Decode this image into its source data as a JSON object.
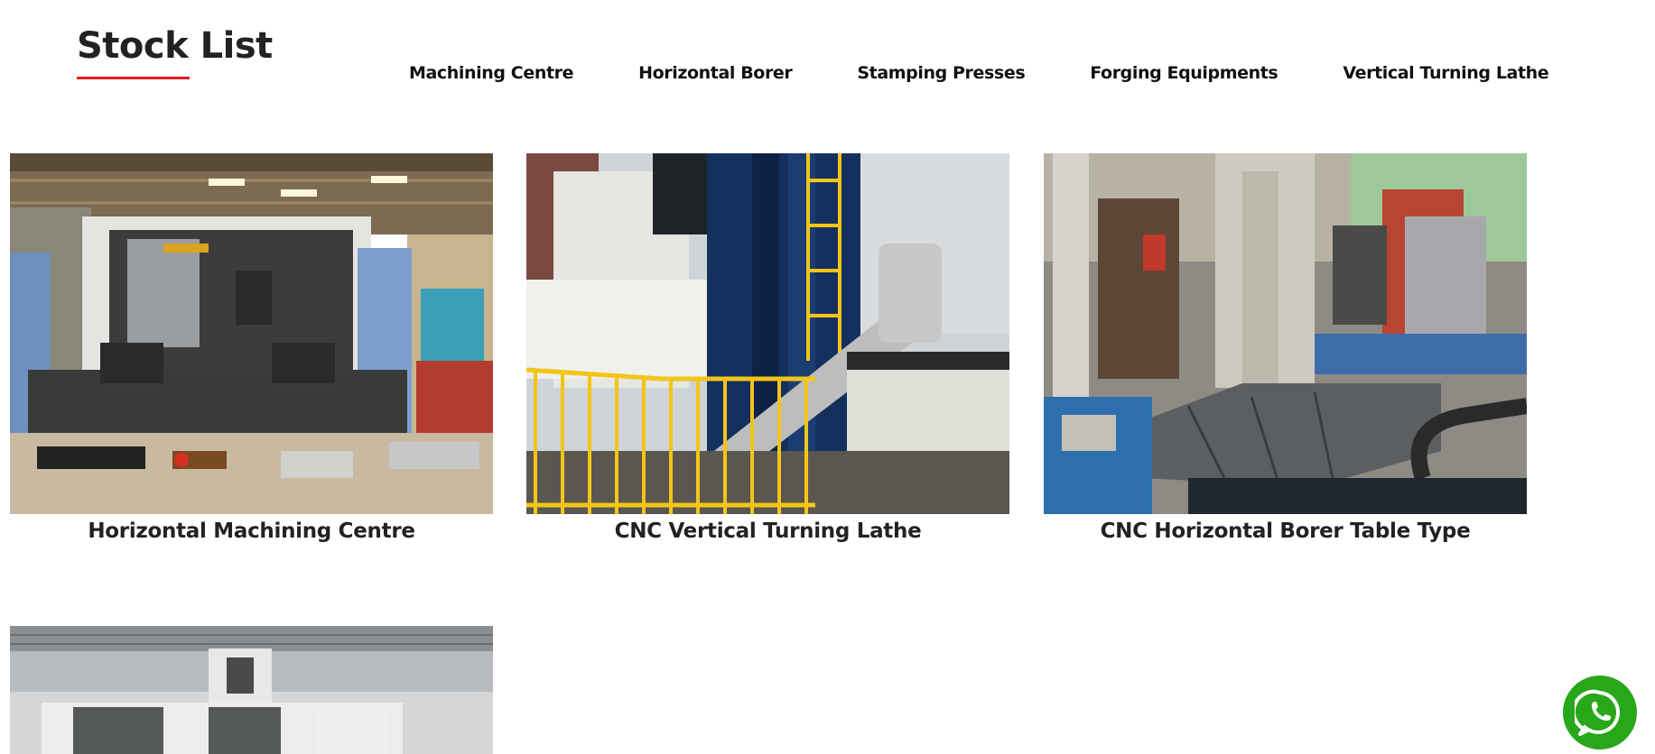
{
  "header": {
    "title": "Stock List",
    "accent_color": "#e02020"
  },
  "tabs": [
    {
      "label": "Machining Centre"
    },
    {
      "label": "Horizontal Borer"
    },
    {
      "label": "Stamping Presses"
    },
    {
      "label": "Forging Equipments"
    },
    {
      "label": "Vertical Turning Lathe"
    }
  ],
  "products": [
    {
      "title": "Horizontal Machining Centre"
    },
    {
      "title": "CNC Vertical Turning Lathe"
    },
    {
      "title": "CNC Horizontal Borer Table Type"
    },
    {
      "title": ""
    }
  ],
  "whatsapp": {
    "icon": "whatsapp-icon",
    "color": "#29a71a"
  }
}
